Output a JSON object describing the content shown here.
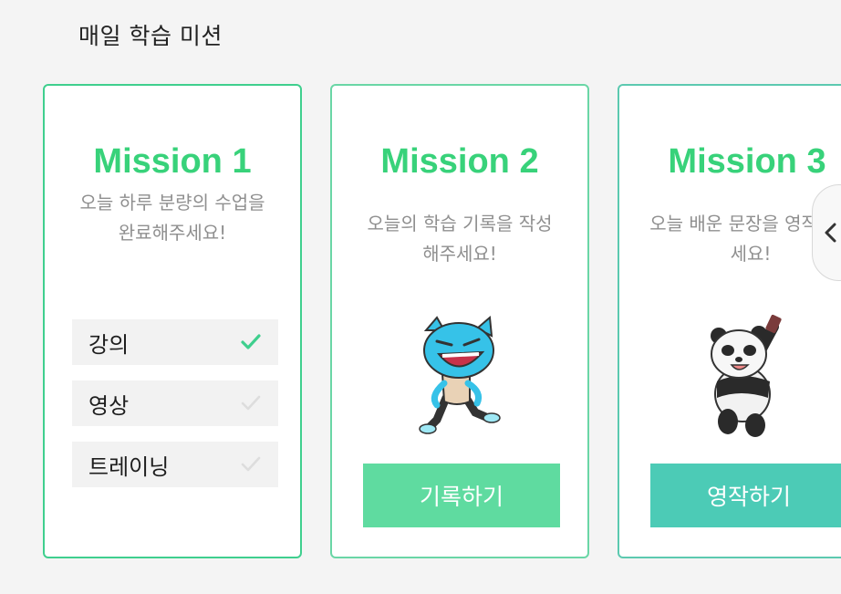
{
  "section": {
    "title": "매일 학습 미션"
  },
  "missions": [
    {
      "title": "Mission 1",
      "description": "오늘 하루 분량의 수업을 완료해주세요!",
      "tasks": [
        {
          "label": "강의",
          "done": true
        },
        {
          "label": "영상",
          "done": false
        },
        {
          "label": "트레이닝",
          "done": false
        }
      ]
    },
    {
      "title": "Mission 2",
      "description": "오늘의 학습 기록을 작성해주세요!",
      "button_label": "기록하기"
    },
    {
      "title": "Mission 3",
      "description": "오늘 배운 문장을 영작해주세요!",
      "button_label": "영작하기"
    }
  ],
  "colors": {
    "accent_green": "#38d27a",
    "check_done": "#3fcf8e",
    "check_pending": "#dddddd",
    "button_mission2": "#5fdba0",
    "button_mission3": "#4ccbb6"
  },
  "icons": {
    "check": "check-icon",
    "nav": "chevron-left-icon",
    "mission2_character": "blue-cat-character",
    "mission3_character": "panda-character"
  }
}
